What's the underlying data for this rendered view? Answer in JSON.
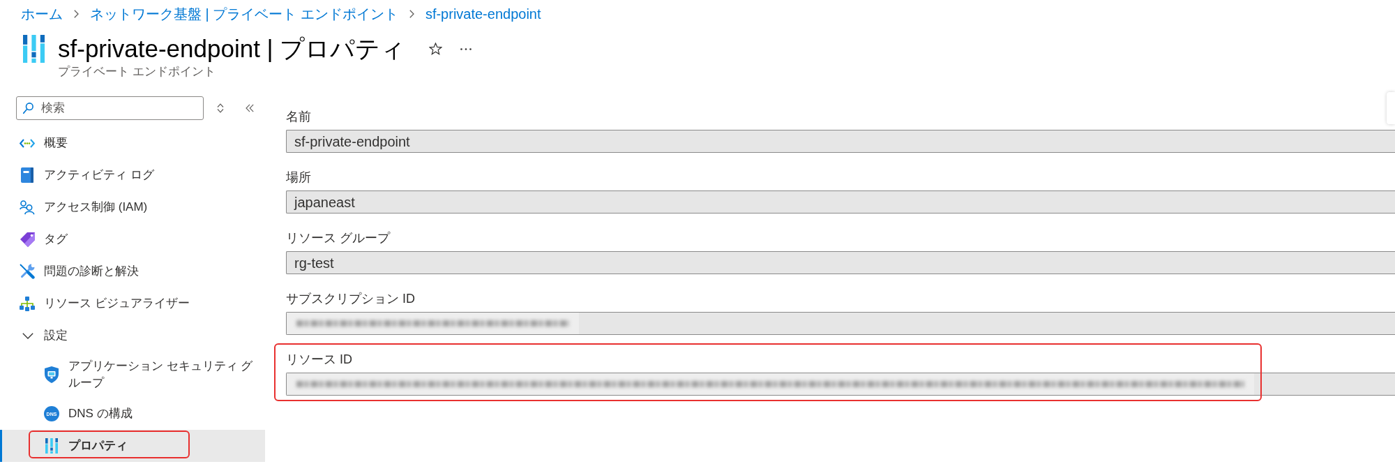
{
  "breadcrumb": [
    {
      "label": "ホーム"
    },
    {
      "label": "ネットワーク基盤 | プライベート エンドポイント"
    },
    {
      "label": "sf-private-endpoint"
    }
  ],
  "header": {
    "title": "sf-private-endpoint | プロパティ",
    "subtitle": "プライベート エンドポイント"
  },
  "sidebar": {
    "search": {
      "placeholder": "検索"
    },
    "items": [
      {
        "kind": "link",
        "label": "概要",
        "selected": false
      },
      {
        "kind": "link",
        "label": "アクティビティ ログ",
        "selected": false
      },
      {
        "kind": "link",
        "label": "アクセス制御 (IAM)",
        "selected": false
      },
      {
        "kind": "link",
        "label": "タグ",
        "selected": false
      },
      {
        "kind": "link",
        "label": "問題の診断と解決",
        "selected": false
      },
      {
        "kind": "link",
        "label": "リソース ビジュアライザー",
        "selected": false
      },
      {
        "kind": "group",
        "label": "設定",
        "selected": false,
        "expanded": true,
        "children": [
          {
            "label": "アプリケーション セキュリティ グループ",
            "selected": false,
            "annotated": false
          },
          {
            "label": "DNS の構成",
            "badge": "DNS",
            "selected": false,
            "annotated": false
          },
          {
            "label": "プロパティ",
            "selected": true,
            "annotated": true
          }
        ]
      }
    ]
  },
  "fields": [
    {
      "kind": "text",
      "label": "名前",
      "value": "sf-private-endpoint",
      "annotated": false
    },
    {
      "kind": "text",
      "label": "場所",
      "value": "japaneast",
      "annotated": false
    },
    {
      "kind": "text",
      "label": "リソース グループ",
      "value": "rg-test",
      "annotated": false
    },
    {
      "kind": "guid",
      "label": "サブスクリプション ID",
      "annotated": false
    },
    {
      "kind": "path",
      "label": "リソース ID",
      "annotated": true
    }
  ]
}
